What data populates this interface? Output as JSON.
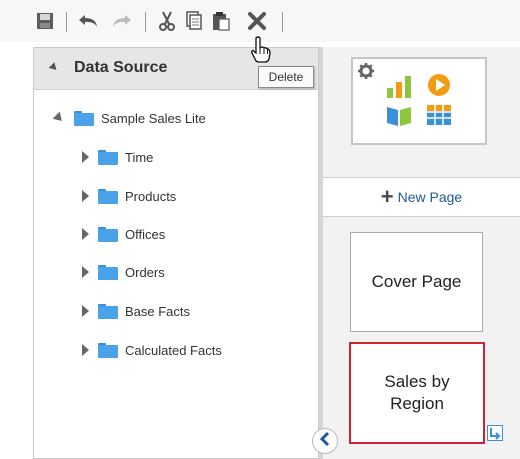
{
  "toolbar": {
    "tooltip": "Delete",
    "buttons": [
      "save-icon",
      "undo-icon",
      "redo-icon",
      "cut-icon",
      "copy-icon",
      "paste-icon",
      "delete-icon"
    ]
  },
  "data_source": {
    "title": "Data Source",
    "root": "Sample Sales Lite",
    "folders": [
      "Time",
      "Products",
      "Offices",
      "Orders",
      "Base Facts",
      "Calculated Facts"
    ]
  },
  "pages": {
    "new_page": "New Page",
    "cover_page": "Cover Page",
    "sales_by_region": "Sales by Region"
  },
  "colors": {
    "accent": "#1f5b9a",
    "folder": "#4aa3e8",
    "selected_border": "#cc2233",
    "chart_orange": "#f39c12",
    "chart_green": "#8cc63f",
    "chart_blue": "#3a8fd9"
  }
}
